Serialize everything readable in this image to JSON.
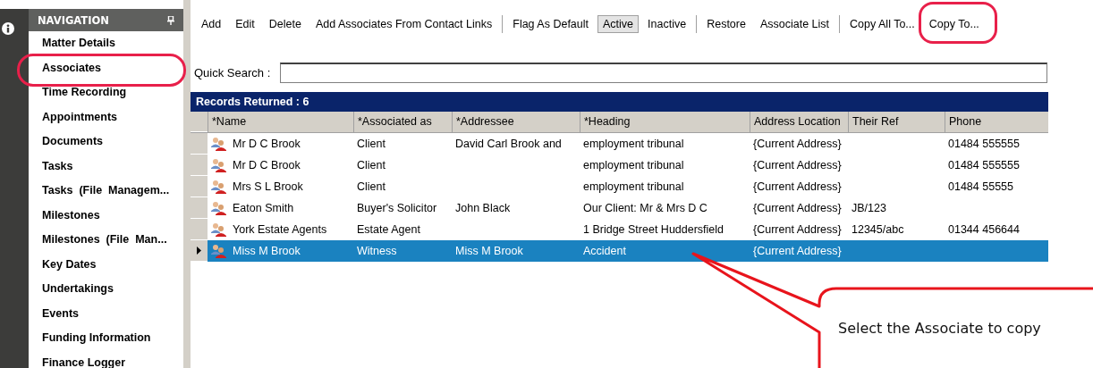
{
  "navigation": {
    "title": "NAVIGATION",
    "items": [
      {
        "label": "Matter Details",
        "highlighted": false
      },
      {
        "label": "Associates",
        "highlighted": true
      },
      {
        "label": "Time Recording",
        "highlighted": false
      },
      {
        "label": "Appointments",
        "highlighted": false
      },
      {
        "label": "Documents",
        "highlighted": false
      },
      {
        "label": "Tasks",
        "highlighted": false
      },
      {
        "label": "Tasks  (File  Managem...",
        "highlighted": false
      },
      {
        "label": "Milestones",
        "highlighted": false
      },
      {
        "label": "Milestones  (File  Man...",
        "highlighted": false
      },
      {
        "label": "Key Dates",
        "highlighted": false
      },
      {
        "label": "Undertakings",
        "highlighted": false
      },
      {
        "label": "Events",
        "highlighted": false
      },
      {
        "label": "Funding Information",
        "highlighted": false
      },
      {
        "label": "Finance Logger",
        "highlighted": false
      }
    ]
  },
  "toolbar": [
    {
      "items": [
        {
          "label": "Add",
          "selected": false,
          "highlighted": false
        },
        {
          "label": "Edit",
          "selected": false,
          "highlighted": false
        },
        {
          "label": "Delete",
          "selected": false,
          "highlighted": false
        },
        {
          "label": "Add Associates From Contact Links",
          "selected": false,
          "highlighted": false
        }
      ]
    },
    {
      "items": [
        {
          "label": "Flag As Default",
          "selected": false,
          "highlighted": false
        },
        {
          "label": "Active",
          "selected": true,
          "highlighted": false
        },
        {
          "label": "Inactive",
          "selected": false,
          "highlighted": false
        }
      ]
    },
    {
      "items": [
        {
          "label": "Restore",
          "selected": false,
          "highlighted": false
        },
        {
          "label": "Associate List",
          "selected": false,
          "highlighted": false
        }
      ]
    },
    {
      "items": [
        {
          "label": "Copy All To...",
          "selected": false,
          "highlighted": false
        },
        {
          "label": "Copy To...",
          "selected": false,
          "highlighted": true
        }
      ]
    }
  ],
  "quick_search": {
    "label": "Quick Search :"
  },
  "table": {
    "caption": "Records Returned : 6",
    "columns": [
      "*Name",
      "*Associated as",
      "*Addressee",
      "*Heading",
      "Address Location",
      "Their Ref",
      "Phone"
    ],
    "rows": [
      {
        "selected": false,
        "cells": [
          "Mr D C Brook",
          "Client",
          "David Carl Brook and",
          "employment tribunal",
          "{Current Address}",
          "",
          "01484 555555"
        ]
      },
      {
        "selected": false,
        "cells": [
          "Mr D C Brook",
          "Client",
          "",
          "employment tribunal",
          "{Current Address}",
          "",
          "01484 555555"
        ]
      },
      {
        "selected": false,
        "cells": [
          "Mrs S L Brook",
          "Client",
          "",
          "employment tribunal",
          "{Current Address}",
          "",
          "01484 55555"
        ]
      },
      {
        "selected": false,
        "cells": [
          "Eaton Smith",
          "Buyer's Solicitor",
          "John Black",
          "Our Client: Mr & Mrs D C",
          "{Current Address}",
          "JB/123",
          ""
        ]
      },
      {
        "selected": false,
        "cells": [
          "York Estate Agents",
          "Estate Agent",
          "",
          "1 Bridge Street  Huddersfield",
          "{Current Address}",
          "12345/abc",
          "01344 456644"
        ]
      },
      {
        "selected": true,
        "cells": [
          "Miss M Brook",
          "Witness",
          "Miss M Brook",
          "Accident",
          "{Current Address}",
          "",
          ""
        ]
      }
    ]
  },
  "callout": {
    "text": "Select the Associate to copy"
  }
}
